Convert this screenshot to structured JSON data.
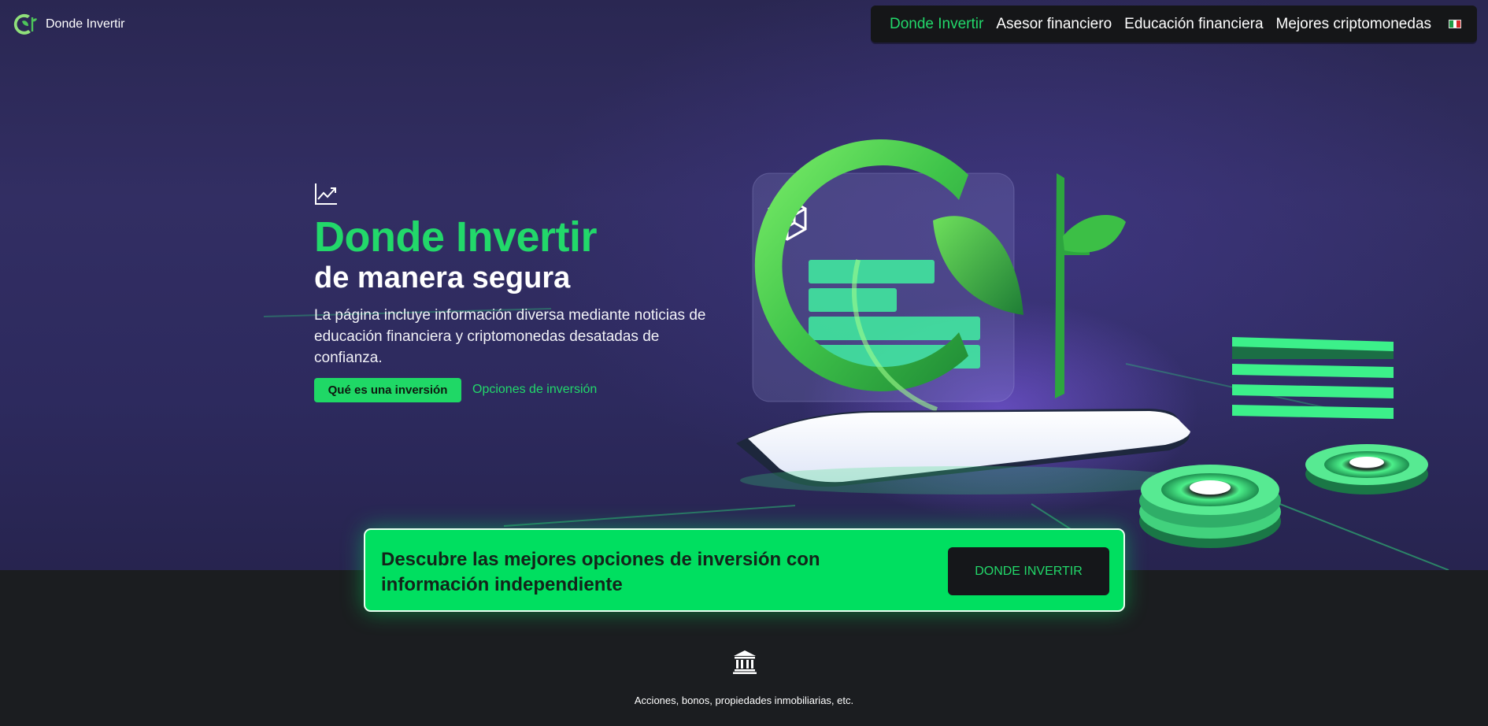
{
  "brand": {
    "name": "Donde Invertir",
    "logo_icon": "leaf-logo-icon"
  },
  "nav": {
    "items": [
      {
        "label": "Donde Invertir",
        "active": true
      },
      {
        "label": "Asesor financiero",
        "active": false
      },
      {
        "label": "Educación financiera",
        "active": false
      },
      {
        "label": "Mejores criptomonedas",
        "active": false
      }
    ],
    "language_icon": "italy-flag-icon"
  },
  "hero": {
    "icon": "trending-chart-icon",
    "title": "Donde Invertir",
    "subtitle": "de manera segura",
    "description": "La página incluye información diversa mediante noticias de educación financiera y criptomonedas desatadas de confianza.",
    "primary_button": "Qué es una inversión",
    "secondary_link": "Opciones de inversión"
  },
  "cta": {
    "text": "Descubre las mejores opciones de inversión con información independiente",
    "button": "DONDE INVERTIR"
  },
  "feature": {
    "icon": "bank-icon",
    "text": "Acciones, bonos, propiedades inmobiliarias, etc."
  },
  "colors": {
    "accent_green": "#22d86a",
    "cta_green": "#00df60",
    "nav_background": "#151618",
    "hero_background": "#2d2a5e",
    "page_background": "#1b1d20"
  }
}
